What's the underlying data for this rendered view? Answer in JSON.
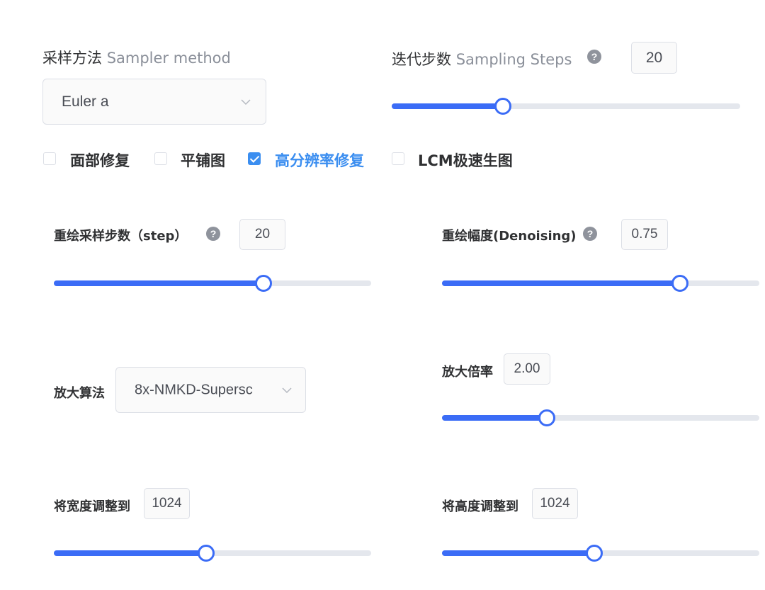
{
  "sampler": {
    "label_cn": "采样方法",
    "label_en": "Sampler method",
    "value": "Euler a",
    "icon": "chevron-down-icon"
  },
  "steps": {
    "label_cn": "迭代步数",
    "label_en": "Sampling Steps",
    "help_icon": "question-circle-icon",
    "help_glyph": "?",
    "value": "20",
    "fraction": 0.32
  },
  "options": [
    {
      "label": "面部修复",
      "checked": false
    },
    {
      "label": "平铺图",
      "checked": false
    },
    {
      "label": "高分辨率修复",
      "checked": true
    },
    {
      "label": "LCM极速生图",
      "checked": false
    }
  ],
  "hires": {
    "resample_steps": {
      "label": "重绘采样步数（step）",
      "help_glyph": "?",
      "value": "20",
      "fraction": 0.66
    },
    "denoising": {
      "label": "重绘幅度(Denoising)",
      "help_glyph": "?",
      "value": "0.75",
      "fraction": 0.75
    },
    "upscaler": {
      "label": "放大算法",
      "value": "8x-NMKD-Supersc"
    },
    "upscale_by": {
      "label": "放大倍率",
      "value": "2.00",
      "fraction": 0.33
    },
    "width": {
      "label": "将宽度调整到",
      "value": "1024",
      "fraction": 0.48
    },
    "height": {
      "label": "将高度调整到",
      "value": "1024",
      "fraction": 0.48
    }
  },
  "colors": {
    "accent": "#3b6cf6",
    "checkbox_active": "#3b8ef0",
    "track": "#e4e7ed"
  }
}
